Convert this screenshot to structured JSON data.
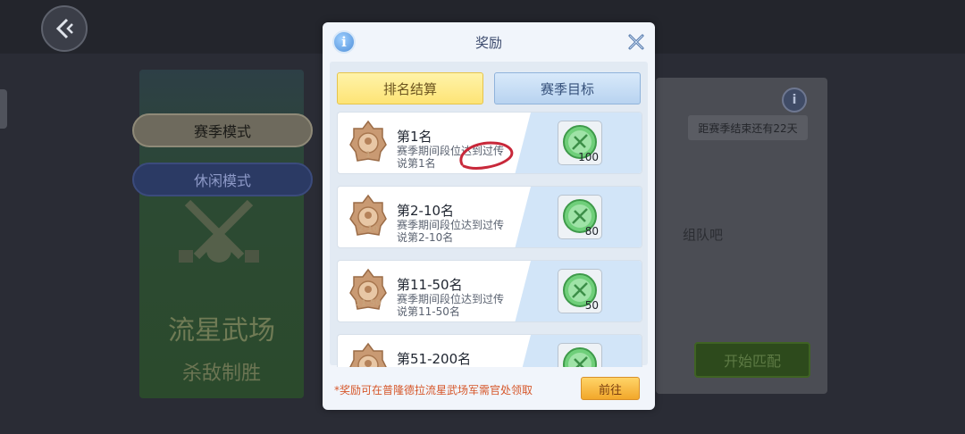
{
  "background": {
    "modes": {
      "season": "赛季模式",
      "casual": "休闲模式"
    },
    "arena": {
      "title": "流星武场",
      "subtitle": "杀敌制胜"
    },
    "season_remaining": "距赛季结束还有22天",
    "team_text": "组队吧",
    "start_match": "开始匹配"
  },
  "modal": {
    "title": "奖励",
    "tabs": [
      {
        "label": "排名结算",
        "active": true
      },
      {
        "label": "赛季目标",
        "active": false
      }
    ],
    "rewards": [
      {
        "medal": "1",
        "rank": "第1名",
        "desc": "赛季期间段位达到过传说第1名",
        "count": "100"
      },
      {
        "medal": "2-10",
        "rank": "第2-10名",
        "desc": "赛季期间段位达到过传说第2-10名",
        "count": "80"
      },
      {
        "medal": "11-50",
        "rank": "第11-50名",
        "desc": "赛季期间段位达到过传说第11-50名",
        "count": "50"
      },
      {
        "medal": "",
        "rank": "第51-200名",
        "desc": "",
        "count": ""
      }
    ],
    "footer_note": "*奖励可在普隆德拉流星武场军需官处领取",
    "go_button": "前往"
  },
  "colors": {
    "accent_yellow": "#fde476",
    "tab_blue": "#b8d3f0",
    "note_orange": "#d6572a",
    "annotation_red": "#c8283a"
  }
}
